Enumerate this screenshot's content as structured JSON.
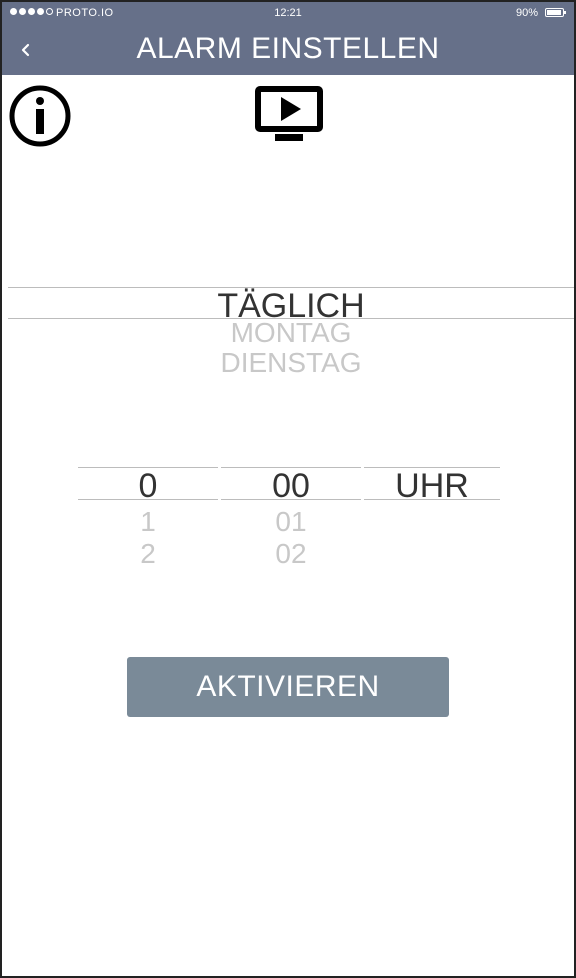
{
  "status_bar": {
    "carrier": "PROTO.IO",
    "time": "12:21",
    "battery": "90%"
  },
  "header": {
    "back_label": "‹",
    "title": "ALARM EINSTELLEN"
  },
  "icons": {
    "info": "info-icon",
    "tv": "tv-play-icon"
  },
  "day_picker": {
    "items": [
      "TÄGLICH",
      "MONTAG",
      "DIENSTAG"
    ],
    "selected": "TÄGLICH"
  },
  "time_picker": {
    "hours": [
      "0",
      "1",
      "2"
    ],
    "minutes": [
      "00",
      "01",
      "02"
    ],
    "unit": "UHR",
    "selected_hour": "0",
    "selected_minute": "00"
  },
  "actions": {
    "activate_label": "AKTIVIEREN"
  },
  "colors": {
    "header_bg": "#667089",
    "button_bg": "#7a8a98",
    "selected_text": "#333333",
    "unselected_text": "#c8c8c8"
  }
}
